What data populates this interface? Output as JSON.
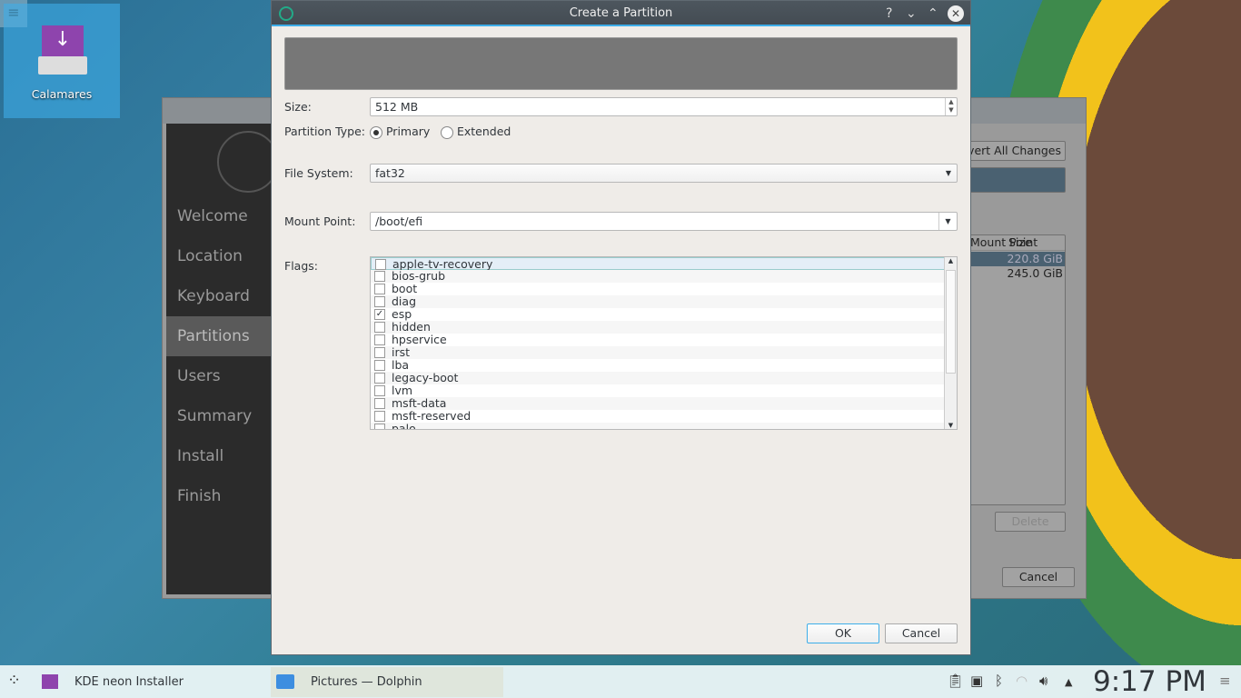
{
  "desktop": {
    "icon_label": "Calamares"
  },
  "installer": {
    "sidebar": [
      "Welcome",
      "Location",
      "Keyboard",
      "Partitions",
      "Users",
      "Summary",
      "Install",
      "Finish"
    ],
    "active": "Partitions",
    "revert_label": "Revert All Changes",
    "columns": [
      "Mount Point",
      "Size"
    ],
    "rows": [
      {
        "size": "220.8 GiB"
      },
      {
        "size": "245.0 GiB"
      }
    ],
    "delete_label": "Delete",
    "cancel_label": "Cancel"
  },
  "dialog": {
    "title": "Create a Partition",
    "size_label": "Size:",
    "size_value": "512 MB",
    "ptype_label": "Partition Type:",
    "primary": "Primary",
    "extended": "Extended",
    "fs_label": "File System:",
    "fs_value": "fat32",
    "mount_label": "Mount Point:",
    "mount_value": "/boot/efi",
    "flags_label": "Flags:",
    "flags": [
      {
        "name": "apple-tv-recovery",
        "checked": false
      },
      {
        "name": "bios-grub",
        "checked": false
      },
      {
        "name": "boot",
        "checked": false
      },
      {
        "name": "diag",
        "checked": false
      },
      {
        "name": "esp",
        "checked": true
      },
      {
        "name": "hidden",
        "checked": false
      },
      {
        "name": "hpservice",
        "checked": false
      },
      {
        "name": "irst",
        "checked": false
      },
      {
        "name": "lba",
        "checked": false
      },
      {
        "name": "legacy-boot",
        "checked": false
      },
      {
        "name": "lvm",
        "checked": false
      },
      {
        "name": "msft-data",
        "checked": false
      },
      {
        "name": "msft-reserved",
        "checked": false
      },
      {
        "name": "palo",
        "checked": false
      }
    ],
    "ok_label": "OK",
    "cancel_label": "Cancel"
  },
  "taskbar": {
    "tasks": [
      "KDE neon Installer",
      "Pictures — Dolphin"
    ],
    "clock": "9:17 PM"
  }
}
